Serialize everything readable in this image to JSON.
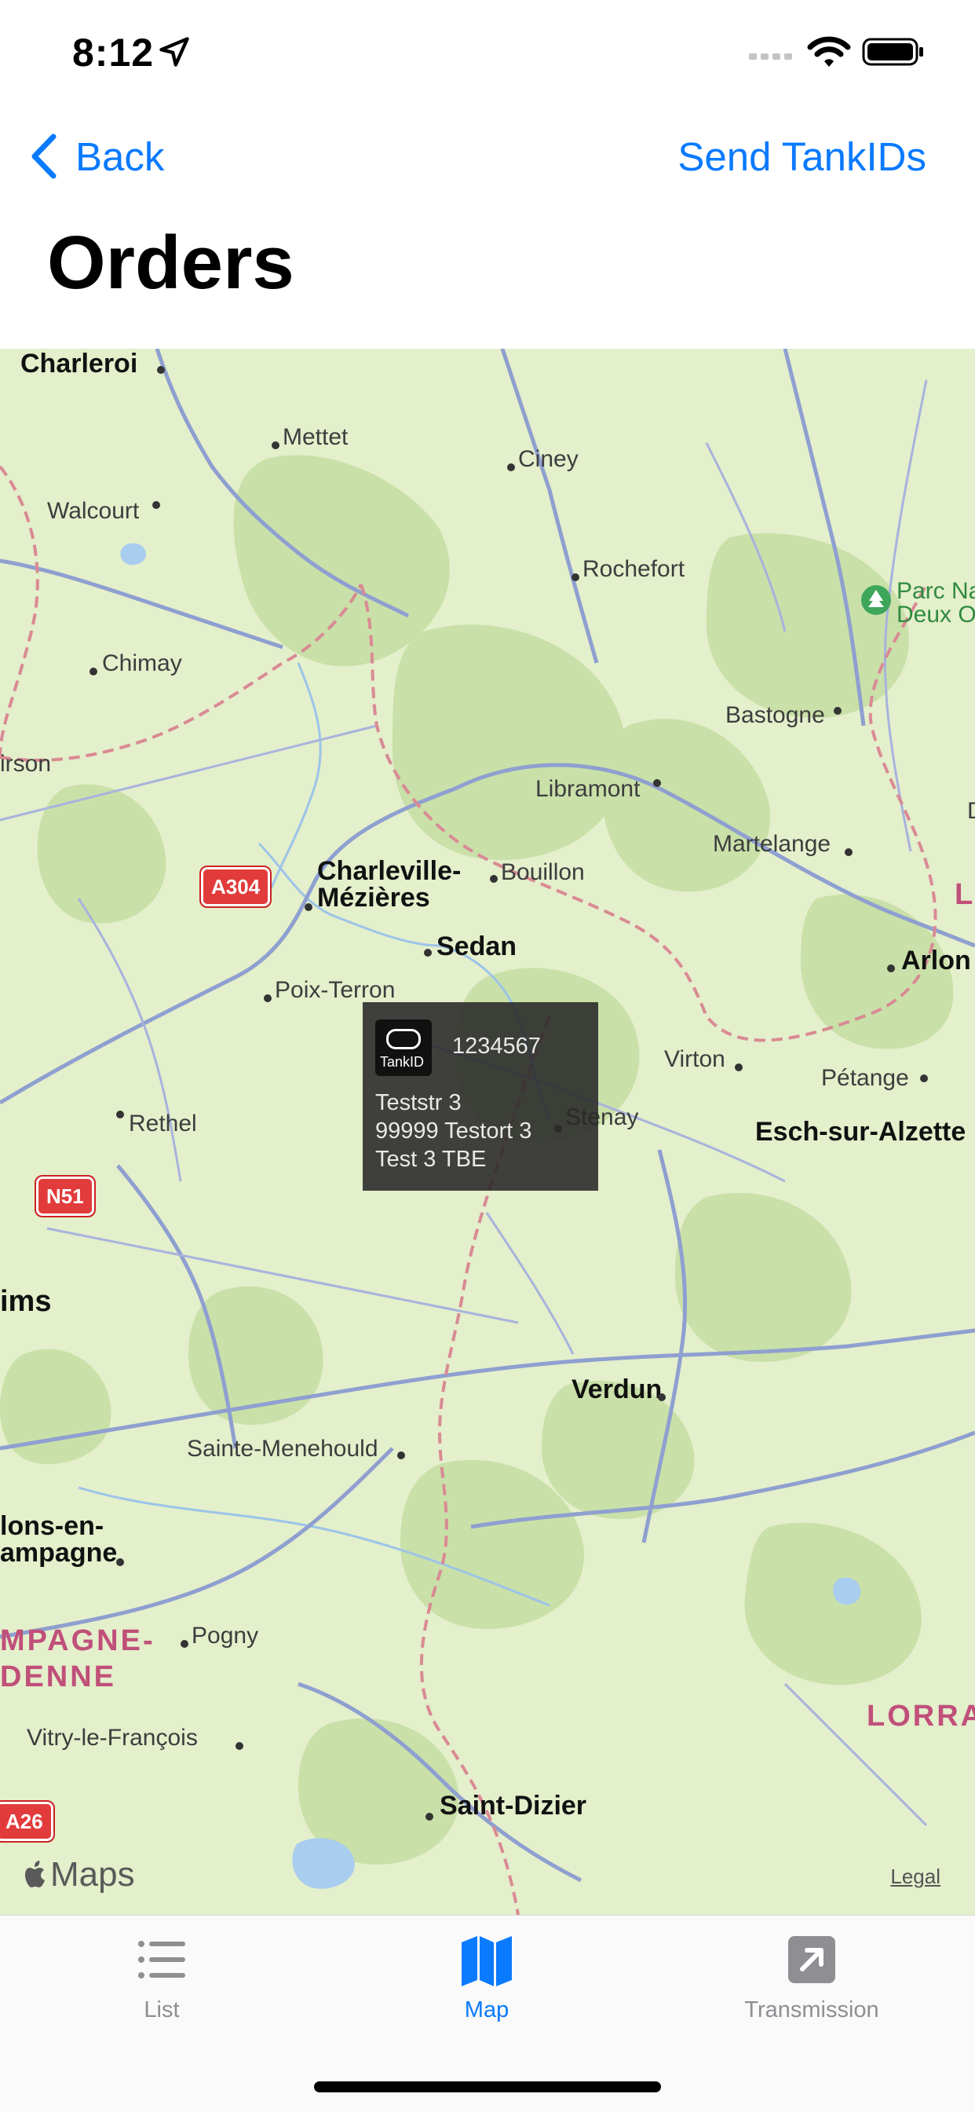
{
  "status_bar": {
    "time": "8:12",
    "icons": [
      "location-arrow-icon",
      "cellular-signal-icon",
      "wifi-icon",
      "battery-icon"
    ]
  },
  "nav": {
    "back_label": "Back",
    "right_action": "Send TankIDs",
    "title": "Orders"
  },
  "map": {
    "places": [
      {
        "name": "Charleroi",
        "style": "big"
      },
      {
        "name": "Mettet",
        "style": "normal"
      },
      {
        "name": "Ciney",
        "style": "normal"
      },
      {
        "name": "Walcourt",
        "style": "normal"
      },
      {
        "name": "Rochefort",
        "style": "normal"
      },
      {
        "name": "Parc Na",
        "style": "park"
      },
      {
        "name": "Deux O",
        "style": "park"
      },
      {
        "name": "Chimay",
        "style": "normal"
      },
      {
        "name": "Bastogne",
        "style": "normal"
      },
      {
        "name": "irson",
        "style": "normal"
      },
      {
        "name": "Libramont",
        "style": "normal"
      },
      {
        "name": "Martelange",
        "style": "normal"
      },
      {
        "name": "Charleville-",
        "style": "big"
      },
      {
        "name": "Mézières",
        "style": "big"
      },
      {
        "name": "Bouillon",
        "style": "normal"
      },
      {
        "name": "Sedan",
        "style": "big"
      },
      {
        "name": "Arlon",
        "style": "big"
      },
      {
        "name": "Poix-Terron",
        "style": "normal"
      },
      {
        "name": "Virton",
        "style": "normal"
      },
      {
        "name": "Pétange",
        "style": "normal"
      },
      {
        "name": "Rethel",
        "style": "normal"
      },
      {
        "name": "Stenay",
        "style": "normal"
      },
      {
        "name": "Esch-sur-Alzette",
        "style": "big"
      },
      {
        "name": "ims",
        "style": "big"
      },
      {
        "name": "Verdun",
        "style": "big"
      },
      {
        "name": "Sainte-Menehould",
        "style": "normal"
      },
      {
        "name": "lons-en-",
        "style": "big"
      },
      {
        "name": "ampagne",
        "style": "big"
      },
      {
        "name": "MPAGNE-",
        "style": "region"
      },
      {
        "name": "DENNE",
        "style": "region"
      },
      {
        "name": "Pogny",
        "style": "normal"
      },
      {
        "name": "LORRA",
        "style": "region"
      },
      {
        "name": "Vitry-le-François",
        "style": "normal"
      },
      {
        "name": "Saint-Dizier",
        "style": "big"
      },
      {
        "name": "D",
        "style": "normal"
      },
      {
        "name": "LU",
        "style": "region"
      }
    ],
    "shields": [
      "A304",
      "N51",
      "A26"
    ],
    "callout": {
      "logo_text": "TankID",
      "id": "1234567",
      "street": "Teststr 3",
      "postal_city": "99999   Testort 3",
      "note": "Test 3 TBE"
    },
    "attribution": "Maps",
    "legal": "Legal"
  },
  "tab_bar": {
    "tabs": [
      {
        "label": "List",
        "icon": "list-icon",
        "active": false
      },
      {
        "label": "Map",
        "icon": "map-icon",
        "active": true
      },
      {
        "label": "Transmission",
        "icon": "transmission-arrow-icon",
        "active": false
      }
    ]
  },
  "colors": {
    "accent": "#0a7aff",
    "map_land": "#e4efcb",
    "map_forest": "#c9e0a8",
    "map_roads": "#8e9fd0",
    "border": "#d98a94",
    "inactive_tab": "#8e8e93"
  }
}
